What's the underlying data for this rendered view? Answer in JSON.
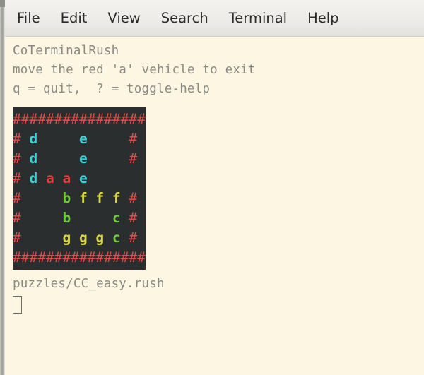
{
  "menu": {
    "items": [
      {
        "label": "File",
        "name": "menu-file"
      },
      {
        "label": "Edit",
        "name": "menu-edit"
      },
      {
        "label": "View",
        "name": "menu-view"
      },
      {
        "label": "Search",
        "name": "menu-search"
      },
      {
        "label": "Terminal",
        "name": "menu-terminal"
      },
      {
        "label": "Help",
        "name": "menu-help"
      }
    ]
  },
  "terminal": {
    "help_lines": [
      "CoTerminalRush",
      "move the red 'a' vehicle to exit",
      "q = quit,  ? = toggle-help"
    ],
    "filename": "puzzles/CC_easy.rush",
    "cursor": "block-cursor"
  },
  "board": {
    "columns": 8,
    "rows": 8,
    "background": "#2b2e2e",
    "colors": {
      "wall": "#e04b4b",
      "a": "#e03c3c",
      "b": "#6ec83c",
      "c": "#6ec83c",
      "d": "#3ccfd4",
      "e": "#3ccfd4",
      "f": "#d8d840",
      "g": "#d8d840"
    },
    "legend": {
      "wall": "#",
      "player": "a",
      "exit_row": 3
    },
    "grid": [
      [
        "#",
        "#",
        "#",
        "#",
        "#",
        "#",
        "#",
        "#"
      ],
      [
        "#",
        "d",
        " ",
        " ",
        "e",
        " ",
        " ",
        "#"
      ],
      [
        "#",
        "d",
        " ",
        " ",
        "e",
        " ",
        " ",
        "#"
      ],
      [
        "#",
        "d",
        "a",
        "a",
        "e",
        " ",
        " ",
        " "
      ],
      [
        "#",
        " ",
        " ",
        "b",
        "f",
        "f",
        "f",
        "#"
      ],
      [
        "#",
        " ",
        " ",
        "b",
        " ",
        " ",
        "c",
        "#"
      ],
      [
        "#",
        " ",
        " ",
        "g",
        "g",
        "g",
        "c",
        "#"
      ],
      [
        "#",
        "#",
        "#",
        "#",
        "#",
        "#",
        "#",
        "#"
      ]
    ]
  }
}
